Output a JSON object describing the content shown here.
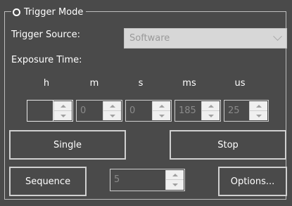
{
  "group": {
    "title": "Trigger Mode"
  },
  "trigger_source": {
    "label": "Trigger Source:",
    "value": "Software"
  },
  "exposure": {
    "label": "Exposure Time:",
    "units": {
      "h": "h",
      "m": "m",
      "s": "s",
      "ms": "ms",
      "us": "us"
    },
    "values": {
      "h": "",
      "m": "0",
      "s": "0",
      "ms": "185",
      "us": "25"
    }
  },
  "buttons": {
    "single": "Single",
    "stop": "Stop",
    "sequence": "Sequence",
    "options": "Options..."
  },
  "sequence_count": "5",
  "icons": {
    "up": "spin-up-icon",
    "down": "spin-down-icon",
    "dropdown": "chevron-down-icon",
    "radio": "radio-icon"
  }
}
